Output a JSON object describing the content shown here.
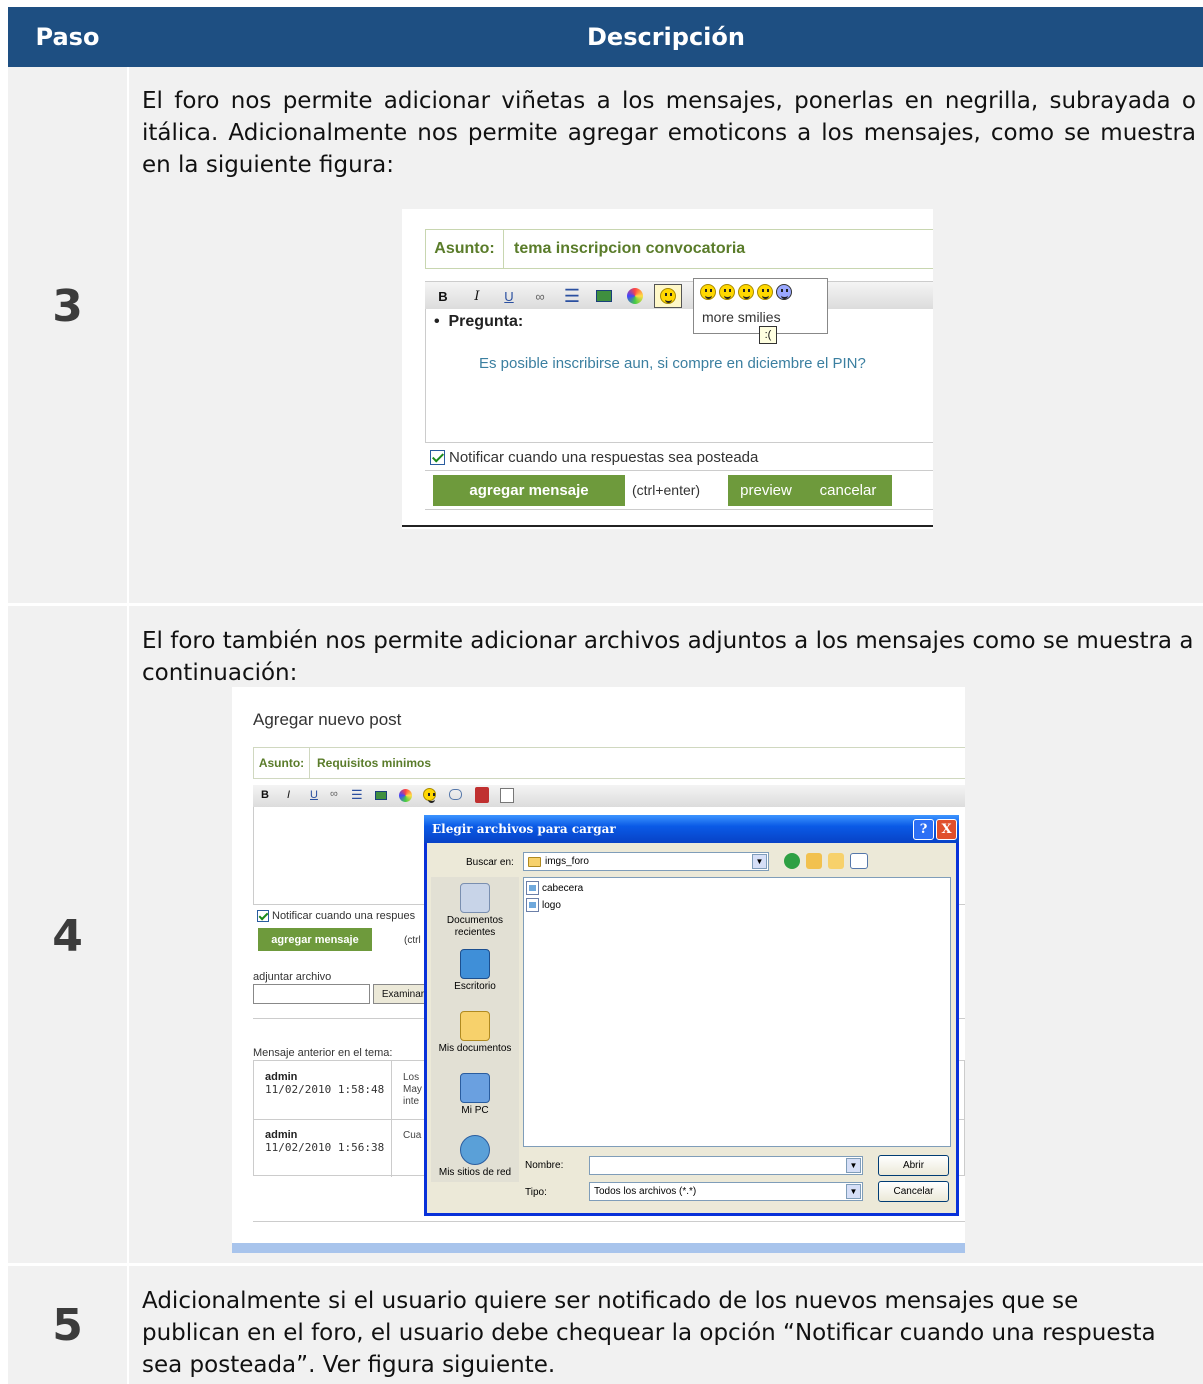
{
  "table": {
    "header": {
      "col_step": "Paso",
      "col_desc": "Descripción"
    },
    "rows": [
      {
        "step": "3",
        "text": "El foro nos permite adicionar viñetas a los mensajes, ponerlas en negrilla, subrayada o itálica.  Adicionalmente nos permite agregar emoticons a los mensajes, como se muestra en la siguiente figura:"
      },
      {
        "step": "4",
        "text": "El foro también nos permite adicionar archivos adjuntos a los mensajes como se muestra a continuación:"
      },
      {
        "step": "5",
        "text": "Adicionalmente si el usuario quiere ser notificado de los nuevos mensajes que se publican en el foro, el usuario debe chequear la opción “Notificar cuando una respuesta sea posteada”.  Ver figura siguiente."
      }
    ]
  },
  "figure1": {
    "subject_label": "Asunto:",
    "subject_value": "tema inscripcion convocatoria",
    "toolbar": {
      "bold": "B",
      "italic": "I",
      "underline": "U"
    },
    "more_smilies": "more smilies",
    "cursor_tip": ":(",
    "bullet_text": "Pregunta:",
    "question": "Es posible inscribirse aun, si compre en diciembre el PIN?",
    "notify": "Notificar cuando una respuestas sea posteada",
    "add_button": "agregar mensaje",
    "shortcut": "(ctrl+enter)",
    "preview": "preview",
    "cancel": "cancelar"
  },
  "figure2": {
    "title": "Agregar nuevo post",
    "subject_label": "Asunto:",
    "subject_value": "Requisitos minimos",
    "toolbar": {
      "bold": "B",
      "italic": "I",
      "underline": "U"
    },
    "notify": "Notificar cuando una respues",
    "add_button": "agregar mensaje",
    "shortcut": "(ctrl",
    "attach_label": "adjuntar archivo",
    "browse": "Examinar",
    "prev_label": "Mensaje anterior en el tema:",
    "messages": [
      {
        "author": "admin",
        "date": "11/02/2010 1:58:48",
        "text_lines": [
          "Los",
          "May",
          "inte"
        ]
      },
      {
        "author": "admin",
        "date": "11/02/2010 1:56:38",
        "text_lines": [
          "Cua"
        ]
      }
    ],
    "dialog": {
      "title": "Elegir archivos para cargar",
      "help": "?",
      "close": "X",
      "look_in_label": "Buscar en:",
      "look_in_value": "imgs_foro",
      "places": [
        "Documentos recientes",
        "Escritorio",
        "Mis documentos",
        "Mi PC",
        "Mis sitios de red"
      ],
      "files": [
        "cabecera",
        "logo"
      ],
      "name_label": "Nombre:",
      "type_label": "Tipo:",
      "type_value": "Todos los archivos (*.*)",
      "open_button": "Abrir",
      "cancel_button": "Cancelar"
    }
  },
  "colors": {
    "header_bg": "#1e4f82",
    "cell_bg": "#f1f1f1",
    "forum_green": "#6e9a3c",
    "xp_blue": "#0a5ae6"
  }
}
